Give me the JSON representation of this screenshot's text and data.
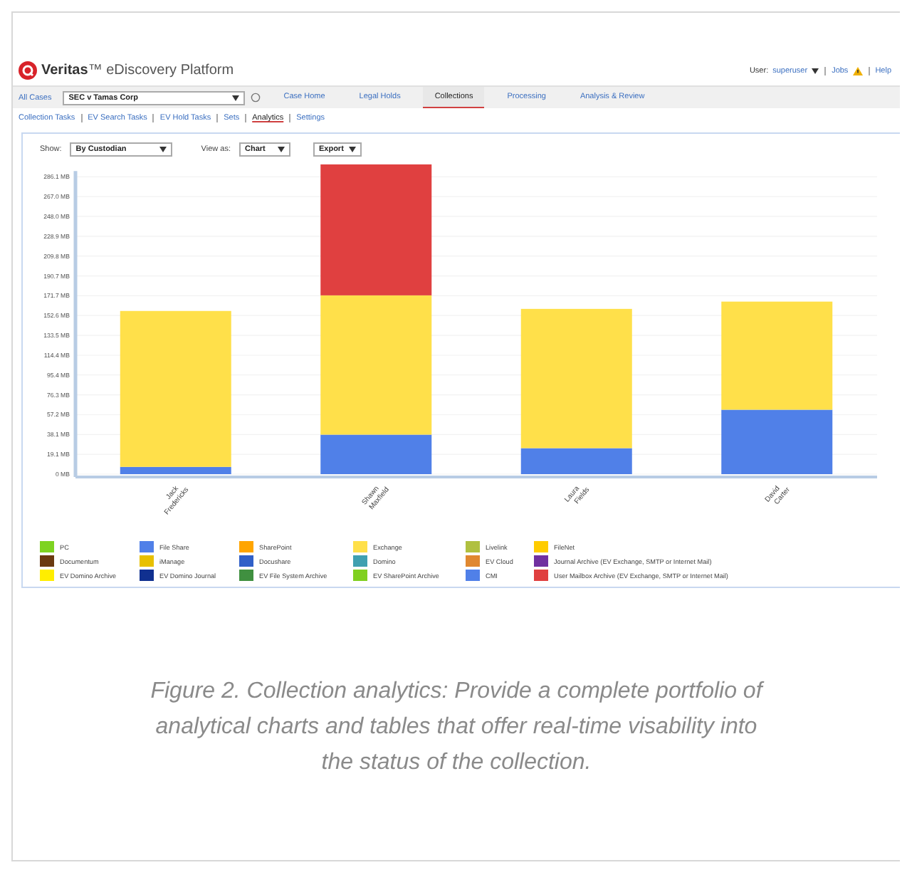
{
  "header": {
    "logo_text": "**Veritas**™ eDiscovery Platform",
    "user_label": "User:",
    "user_name": "superuser",
    "jobs": "Jobs",
    "help": "Help"
  },
  "nav": {
    "all_cases": "All Cases",
    "case_select": "SEC v Tamas Corp",
    "tabs": [
      {
        "label": "Case Home",
        "selected": false
      },
      {
        "label": "Legal Holds",
        "selected": false
      },
      {
        "label": "Collections",
        "selected": true
      },
      {
        "label": "Processing",
        "selected": false
      },
      {
        "label": "Analysis & Review",
        "selected": false
      }
    ]
  },
  "subnav": [
    {
      "label": "Collection Tasks",
      "selected": false
    },
    {
      "label": "EV Search Tasks",
      "selected": false
    },
    {
      "label": "EV Hold Tasks",
      "selected": false
    },
    {
      "label": "Sets",
      "selected": false
    },
    {
      "label": "Analytics",
      "selected": true
    },
    {
      "label": "Settings",
      "selected": false
    }
  ],
  "toolbar": {
    "show_label": "Show:",
    "show_value": "By Custodian",
    "view_label": "View as:",
    "view_value": "Chart",
    "export": "Export"
  },
  "chart": {
    "chart_data": {
      "type": "bar",
      "stacked": true,
      "grid": true,
      "categories": [
        "Jack Fredericks",
        "Shawn Maxfield",
        "Laura Fields",
        "David Carter"
      ],
      "series": [
        {
          "color": "#5080e8",
          "values": [
            7,
            38,
            25,
            62
          ]
        },
        {
          "color": "#ffe04a",
          "values": [
            150,
            134,
            134,
            104
          ]
        },
        {
          "color": "#e04040",
          "values": [
            0,
            126,
            0,
            0
          ]
        }
      ],
      "ylim": [
        0,
        300
      ],
      "yticks": [
        {
          "value": 0,
          "label": "0 MB"
        },
        {
          "value": 19.1,
          "label": "19.1 MB"
        },
        {
          "value": 38.1,
          "label": "38.1 MB"
        },
        {
          "value": 57.2,
          "label": "57.2 MB"
        },
        {
          "value": 76.3,
          "label": "76.3 MB"
        },
        {
          "value": 95.4,
          "label": "95.4 MB"
        },
        {
          "value": 114.4,
          "label": "114.4 MB"
        },
        {
          "value": 133.5,
          "label": "133.5 MB"
        },
        {
          "value": 152.6,
          "label": "152.6 MB"
        },
        {
          "value": 171.7,
          "label": "171.7 MB"
        },
        {
          "value": 190.7,
          "label": "190.7 MB"
        },
        {
          "value": 209.8,
          "label": "209.8 MB"
        },
        {
          "value": 228.9,
          "label": "228.9 MB"
        },
        {
          "value": 248.0,
          "label": "248.0 MB"
        },
        {
          "value": 267.0,
          "label": "267.0 MB"
        },
        {
          "value": 286.1,
          "label": "286.1 MB"
        }
      ]
    },
    "legend": [
      {
        "name": "PC",
        "color": "#7ed321"
      },
      {
        "name": "File Share",
        "color": "#5080e8"
      },
      {
        "name": "SharePoint",
        "color": "#ffa500"
      },
      {
        "name": "Exchange",
        "color": "#ffe04a"
      },
      {
        "name": "Livelink",
        "color": "#b0c040"
      },
      {
        "name": "FileNet",
        "color": "#ffcc00"
      },
      {
        "name": "Documentum",
        "color": "#6b3a10"
      },
      {
        "name": "iManage",
        "color": "#e8c000"
      },
      {
        "name": "Docushare",
        "color": "#3060c8"
      },
      {
        "name": "Domino",
        "color": "#40a0b0"
      },
      {
        "name": "EV Cloud",
        "color": "#e08830"
      },
      {
        "name": "Journal Archive (EV Exchange, SMTP or Internet Mail)",
        "color": "#7030a0"
      },
      {
        "name": "EV Domino Archive",
        "color": "#ffee00"
      },
      {
        "name": "EV Domino Journal",
        "color": "#103090"
      },
      {
        "name": "EV File System Archive",
        "color": "#409040"
      },
      {
        "name": "EV SharePoint Archive",
        "color": "#80d020"
      },
      {
        "name": "CMI",
        "color": "#5080e8"
      },
      {
        "name": "User Mailbox Archive (EV Exchange, SMTP or Internet Mail)",
        "color": "#e04040"
      }
    ]
  },
  "caption": "Figure 2. Collection analytics: Provide a complete portfolio of analytical charts and tables that offer real-time visability into the status of the collection."
}
